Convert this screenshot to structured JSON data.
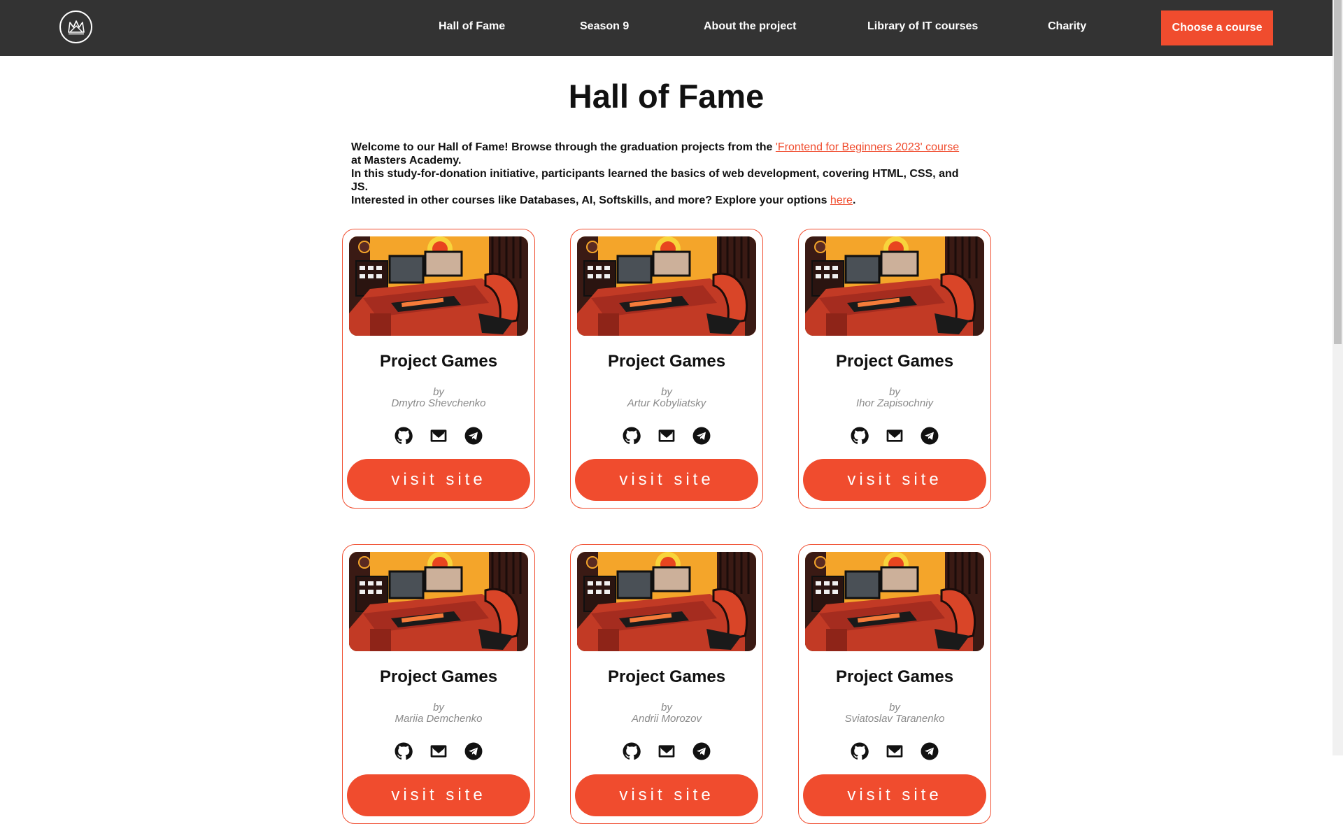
{
  "header": {
    "nav": [
      {
        "label": "Hall of Fame"
      },
      {
        "label": "Season 9"
      },
      {
        "label": "About the project"
      },
      {
        "label": "Library of IT courses"
      },
      {
        "label": "Charity"
      }
    ],
    "cta_label": "Choose a course"
  },
  "main": {
    "title": "Hall of Fame",
    "intro": {
      "line1_a": "Welcome to our Hall of Fame! Browse through the graduation projects from the ",
      "line1_link": "'Frontend for Beginners 2023' course ",
      "line1_b": "at Masters Academy.",
      "line2": "In this study-for-donation initiative, participants learned the basics of web development, covering HTML, CSS, and JS.",
      "line3_a": "Interested in other courses like Databases, AI, Softskills, and more? Explore your options ",
      "line3_link": "here",
      "line3_b": "."
    }
  },
  "cards": [
    {
      "title": "Project Games",
      "by": "by",
      "author": "Dmytro Shevchenko",
      "button": "visit site"
    },
    {
      "title": "Project Games",
      "by": "by",
      "author": "Artur Kobyliatsky",
      "button": "visit site"
    },
    {
      "title": "Project Games",
      "by": "by",
      "author": "Ihor Zapisochniy",
      "button": "visit site"
    },
    {
      "title": "Project Games",
      "by": "by",
      "author": "Mariia Demchenko",
      "button": "visit site"
    },
    {
      "title": "Project Games",
      "by": "by",
      "author": "Andrii Morozov",
      "button": "visit site"
    },
    {
      "title": "Project Games",
      "by": "by",
      "author": "Sviatoslav Taranenko",
      "button": "visit site"
    }
  ],
  "icons": [
    "github-icon",
    "mail-icon",
    "telegram-icon"
  ],
  "colors": {
    "accent": "#f04c2e",
    "header_bg": "#333333"
  }
}
